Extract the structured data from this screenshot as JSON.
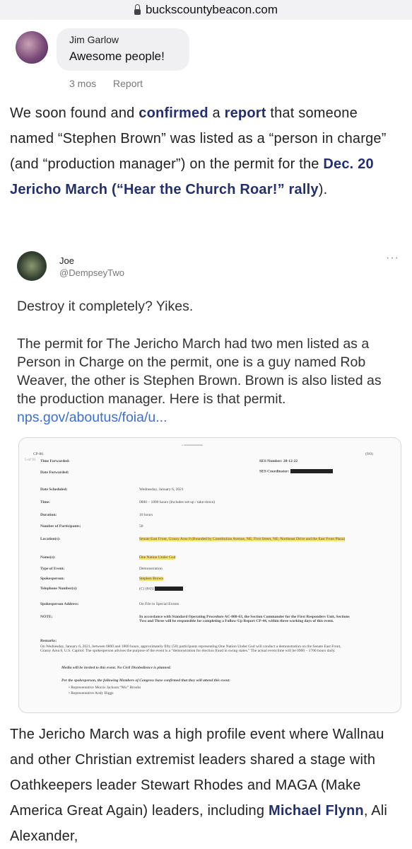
{
  "browser": {
    "url": "buckscountybeacon.com"
  },
  "comment": {
    "author": "Jim Garlow",
    "text": "Awesome people!",
    "time": "3 mos",
    "report": "Report"
  },
  "article": {
    "p1": {
      "t1": "We soon found and ",
      "l1": "confirmed",
      "t2": " a ",
      "l2": "report",
      "t3": " that someone named “Stephen Brown” was listed as a “person in charge” (and “production manager”) on the permit for the ",
      "l3": "Dec. 20 Jericho March (“Hear the Church Roar!” rally",
      "t4": ")."
    },
    "p2": {
      "t1": "The Jericho March was a high profile event where Wallnau and other Christian extremist leaders shared a stage with Oathkeepers leader Stewart Rhodes and MAGA (Make America Great Again) leaders, including ",
      "l1": "Michael Flynn",
      "t2": ", Ali Alexander,"
    }
  },
  "tweet": {
    "name": "Joe",
    "handle": "@DempseyTwo",
    "more": "···",
    "line1": "Destroy it completely? Yikes.",
    "body": "The permit for The Jericho March had two men listed as a Person in Charge on the permit, one is a guy named Rob Weaver, the other is Stephen Brown. Brown is also listed as the production manager. Here is that permit. ",
    "link": "nps.gov/aboutus/foia/u..."
  },
  "permit": {
    "header_left": "CP-86",
    "header_right": "(9/0)",
    "page": "5 of 91",
    "fields": [
      {
        "label": "Time Forwarded:",
        "value": ""
      },
      {
        "label": "Date Forwarded:",
        "value": ""
      },
      {
        "label": "Date Scheduled:",
        "value": "Wednesday, January 6, 2021"
      },
      {
        "label": "Time:",
        "value": "0800 – 1800 hours (Includes set-up / take-down)"
      },
      {
        "label": "Duration:",
        "value": "10 hours"
      },
      {
        "label": "Number of Participants:",
        "value": "50"
      },
      {
        "label": "Location(s):",
        "value": "Senate East Front, Grassy Area 8 (Bounded by Constitution Avenue, NE; First Street, NE; Northeast Drive and the East Front Plaza)"
      },
      {
        "label": "Name(s):",
        "value": "One Nation Under God"
      },
      {
        "label": "Type of Event:",
        "value": "Demonstration"
      },
      {
        "label": "Spokesperson:",
        "value": "Stephen Brown"
      },
      {
        "label": "Telephone Number(s):",
        "value": "(C) (843)"
      },
      {
        "label": "Spokesperson Address:",
        "value": "On File in Special Events"
      },
      {
        "label": "NOTE:",
        "value": "In accordance with Standard Operating Procedure AC-008-63, the Section Commander for the First Responders Unit, Sections Two and Three will be responsible for completing a Follow-Up Report CP-44, within three working days of this event."
      },
      {
        "label": "Remarks:",
        "value": "On Wednesday, January 6, 2021, between 0800 and 1800 hours, approximately fifty (50) participants representing One Nation Under God will conduct a demonstration on the Senate East Front, Grassy Area 8, U.S. Capitol. The spokesperson advises the purpose of the event is a “demonstration for election fraud in swing states.” The actual event time will be 0900 – 1700 hours daily."
      }
    ],
    "ses_number_label": "SES Number:",
    "ses_number": "20-12-22",
    "ses_coord_label": "SES Coordinator:",
    "media": "Media will be invited to this event. No Civil Disobedience is planned.",
    "members": "Per the spokesperson, the following Members of Congress have confirmed that they will attend this event:",
    "rep1": "• Representative Morris Jackson “Mo” Brooks",
    "rep2": "• Representative Andy Biggs"
  }
}
